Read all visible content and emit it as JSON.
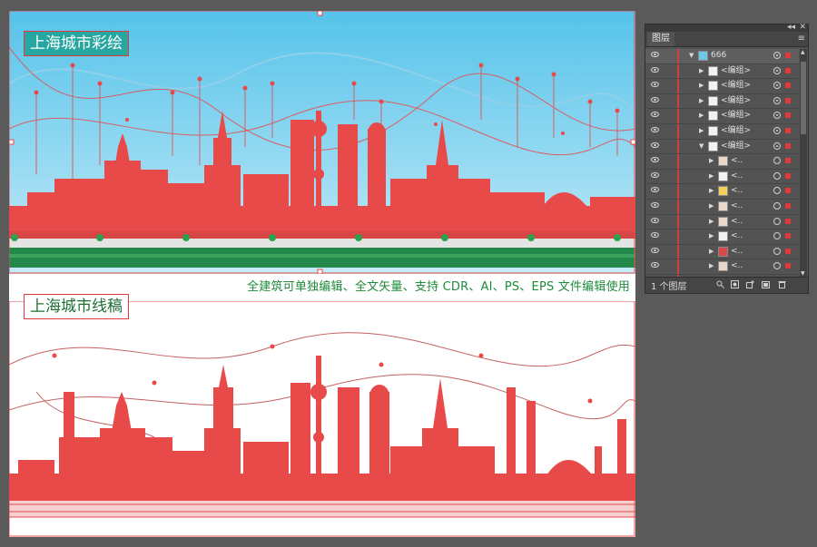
{
  "artboard": {
    "color_title": "上海城市彩绘",
    "line_title": "上海城市线稿",
    "caption": "全建筑可单独编辑、全文矢量、支持 CDR、AI、PS、EPS 文件编辑使用"
  },
  "layers_panel": {
    "tab_label": "图层",
    "collapse_glyph": "◂◂",
    "close_glyph": "✕",
    "menu_glyph": "≡",
    "layer_count": "1 个图层",
    "rows": [
      {
        "label": "666",
        "indent": 0,
        "expanded": true,
        "thumb": "sky"
      },
      {
        "label": "<编组>",
        "indent": 1,
        "expanded": false,
        "thumb": "blank"
      },
      {
        "label": "<编组>",
        "indent": 1,
        "expanded": false,
        "thumb": "blank"
      },
      {
        "label": "<编组>",
        "indent": 1,
        "expanded": false,
        "thumb": "blank"
      },
      {
        "label": "<编组>",
        "indent": 1,
        "expanded": false,
        "thumb": "blank"
      },
      {
        "label": "<编组>",
        "indent": 1,
        "expanded": false,
        "thumb": "blank"
      },
      {
        "label": "<编组>",
        "indent": 1,
        "expanded": true,
        "thumb": "blank"
      },
      {
        "label": "<..",
        "indent": 2,
        "expanded": false,
        "thumb": "building"
      },
      {
        "label": "<..",
        "indent": 2,
        "expanded": false,
        "thumb": "blank"
      },
      {
        "label": "<..",
        "indent": 2,
        "expanded": false,
        "thumb": "yellow"
      },
      {
        "label": "<..",
        "indent": 2,
        "expanded": false,
        "thumb": "building"
      },
      {
        "label": "<..",
        "indent": 2,
        "expanded": false,
        "thumb": "building"
      },
      {
        "label": "<..",
        "indent": 2,
        "expanded": false,
        "thumb": "blank"
      },
      {
        "label": "<..",
        "indent": 2,
        "expanded": false,
        "thumb": "red"
      },
      {
        "label": "<..",
        "indent": 2,
        "expanded": false,
        "thumb": "building"
      },
      {
        "label": "<..",
        "indent": 2,
        "expanded": false,
        "thumb": "building"
      }
    ]
  },
  "colors": {
    "app_background": "#5a5a5a",
    "sky_top": "#55c3ea",
    "sky_bottom": "#bfe7f7",
    "selection_red": "#e84a4a",
    "grass_green": "#23894a",
    "caption_green": "#1f8a3a",
    "title_teal": "#27a7a2"
  }
}
